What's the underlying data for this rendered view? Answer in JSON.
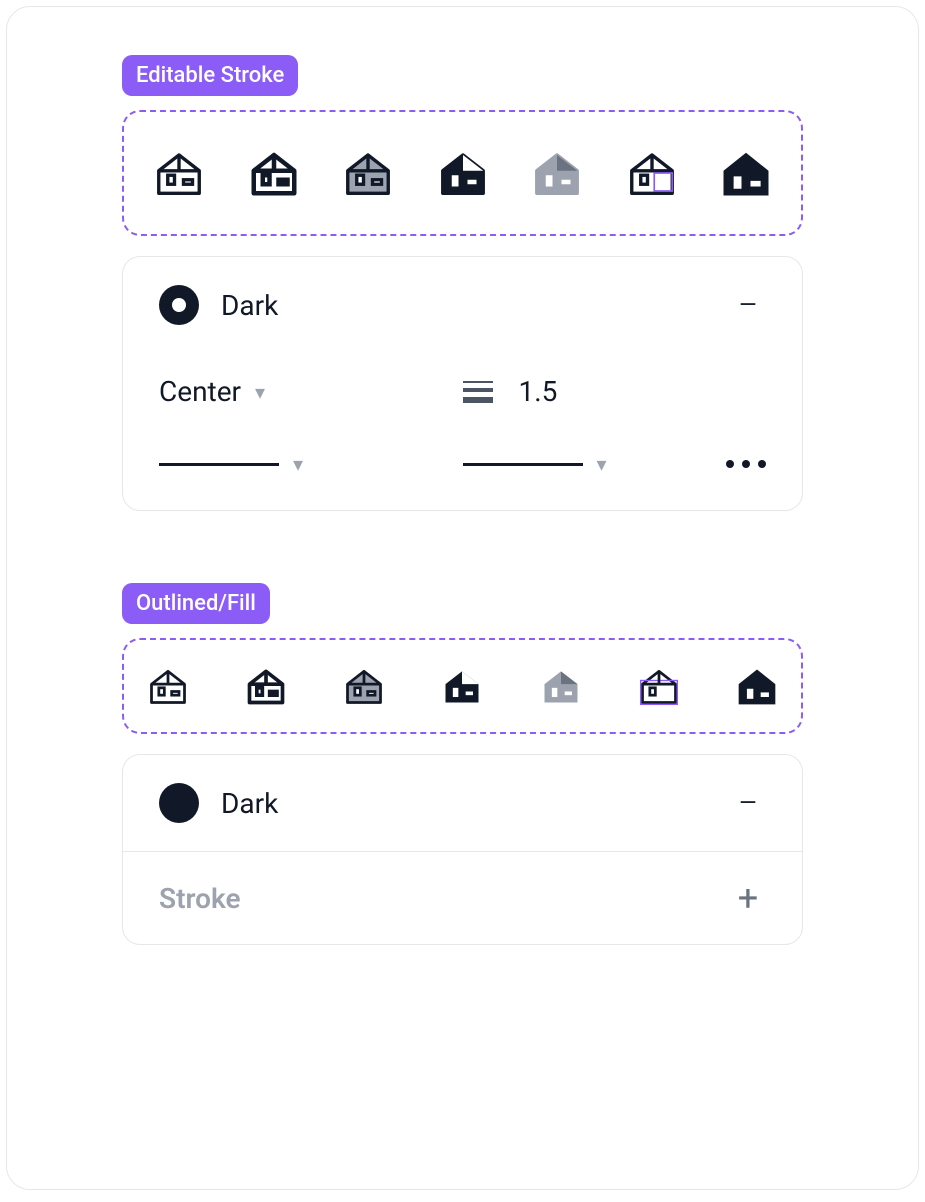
{
  "sections": {
    "editable": {
      "tag": "Editable Stroke",
      "color_label": "Dark",
      "align_label": "Center",
      "weight_value": "1.5"
    },
    "outlined": {
      "tag": "Outlined/Fill",
      "color_label": "Dark",
      "stroke_label": "Stroke"
    }
  },
  "colors": {
    "accent": "#8b5cf6",
    "dark": "#111827",
    "grey": "#9ca3af"
  }
}
